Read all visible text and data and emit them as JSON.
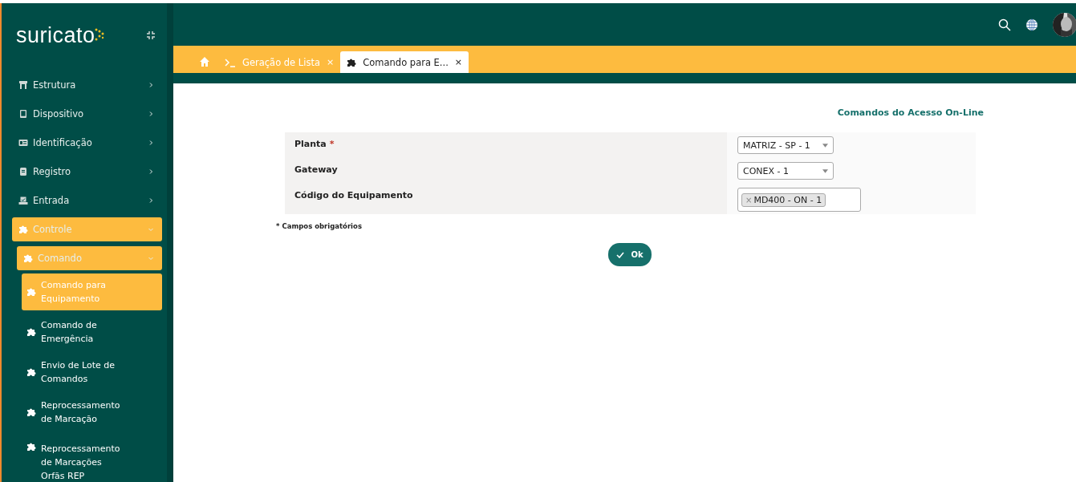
{
  "sidebar": {
    "logo": "suricato",
    "items": [
      {
        "label": "Estrutura",
        "expanded": false
      },
      {
        "label": "Dispositivo",
        "expanded": false
      },
      {
        "label": "Identificação",
        "expanded": false
      },
      {
        "label": "Registro",
        "expanded": false
      },
      {
        "label": "Entrada",
        "expanded": false
      },
      {
        "label": "Controle",
        "expanded": true,
        "children": [
          {
            "label": "Comando",
            "expanded": true,
            "children": [
              {
                "label": "Comando para Equipamento",
                "selected": true
              },
              {
                "label": "Comando de Emergência",
                "selected": false
              },
              {
                "label": "Envio de Lote de Comandos",
                "selected": false
              },
              {
                "label": "Reprocessamento de Marcação",
                "selected": false
              },
              {
                "label": "Reprocessamento de Marcações Orfãs REP",
                "selected": false
              }
            ]
          }
        ]
      }
    ]
  },
  "tabs": [
    {
      "label": "Geração de Lista",
      "selected": false,
      "close": "×"
    },
    {
      "label": "Comando para E...",
      "selected": true,
      "close": "×"
    }
  ],
  "form": {
    "title": "Comandos do Acesso On-Line",
    "fields": [
      {
        "label": "Planta",
        "required": true,
        "kind": "select",
        "value": "MATRIZ - SP - 1"
      },
      {
        "label": "Gateway",
        "required": false,
        "kind": "select",
        "value": "CONEX - 1"
      },
      {
        "label": "Código do Equipamento",
        "required": false,
        "kind": "tags",
        "tags": [
          {
            "label": "MD400 - ON - 1",
            "remove": "×"
          }
        ]
      }
    ],
    "required_mark": "*",
    "note": "* Campos obrigatórios",
    "button": "Ok"
  }
}
